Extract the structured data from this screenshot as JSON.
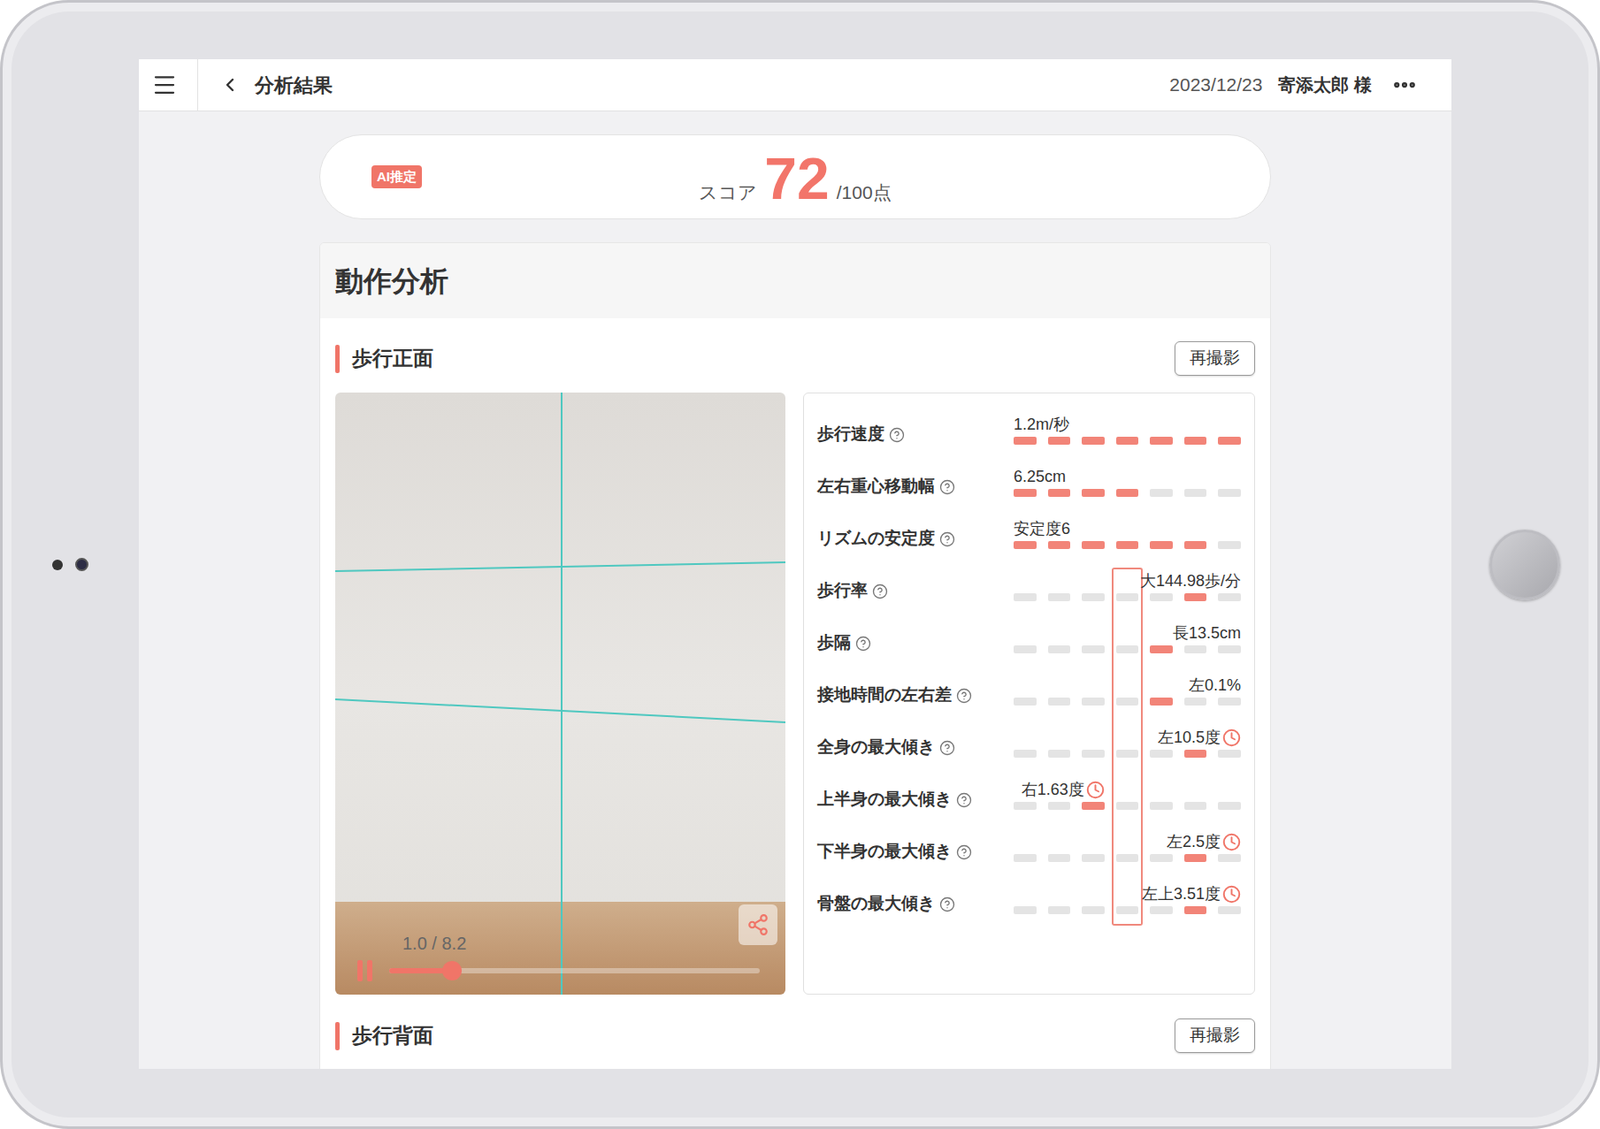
{
  "top_bar": {
    "title": "分析結果",
    "date": "2023/12/23",
    "patient": "寄添太郎 様"
  },
  "score": {
    "badge": "AI推定",
    "label": "スコア",
    "value": "72",
    "max": "/100点"
  },
  "panel": {
    "title": "動作分析"
  },
  "sections": [
    {
      "title": "歩行正面",
      "button": "再撮影",
      "video": {
        "time": "1.0 / 8.2",
        "level": 0.17,
        "playing": true
      },
      "normal_position": 3,
      "metrics": [
        {
          "label": "歩行速度",
          "value": "1.2m/秒",
          "kind": "fill",
          "level": 1,
          "clock": false
        },
        {
          "label": "左右重心移動幅",
          "value": "6.25cm",
          "kind": "fill",
          "level": 0.571,
          "clock": false
        },
        {
          "label": "リズムの安定度",
          "value": "安定度6",
          "kind": "fill",
          "level": 0.857,
          "clock": false
        },
        {
          "label": "歩行率",
          "value": "大144.98歩/分",
          "kind": "marker",
          "position": 5,
          "clock": false
        },
        {
          "label": "歩隔",
          "value": "長13.5cm",
          "kind": "marker",
          "position": 4,
          "clock": false
        },
        {
          "label": "接地時間の左右差",
          "value": "左0.1%",
          "kind": "marker",
          "position": 4,
          "clock": false
        },
        {
          "label": "全身の最大傾き",
          "value": "左10.5度",
          "kind": "marker",
          "position": 5,
          "clock": true
        },
        {
          "label": "上半身の最大傾き",
          "value": "右1.63度",
          "kind": "marker",
          "position": 2,
          "clock": true
        },
        {
          "label": "下半身の最大傾き",
          "value": "左2.5度",
          "kind": "marker",
          "position": 5,
          "clock": true
        },
        {
          "label": "骨盤の最大傾き",
          "value": "左上3.51度",
          "kind": "marker",
          "position": 5,
          "clock": true
        }
      ]
    },
    {
      "title": "歩行背面",
      "button": "再撮影"
    }
  ]
}
